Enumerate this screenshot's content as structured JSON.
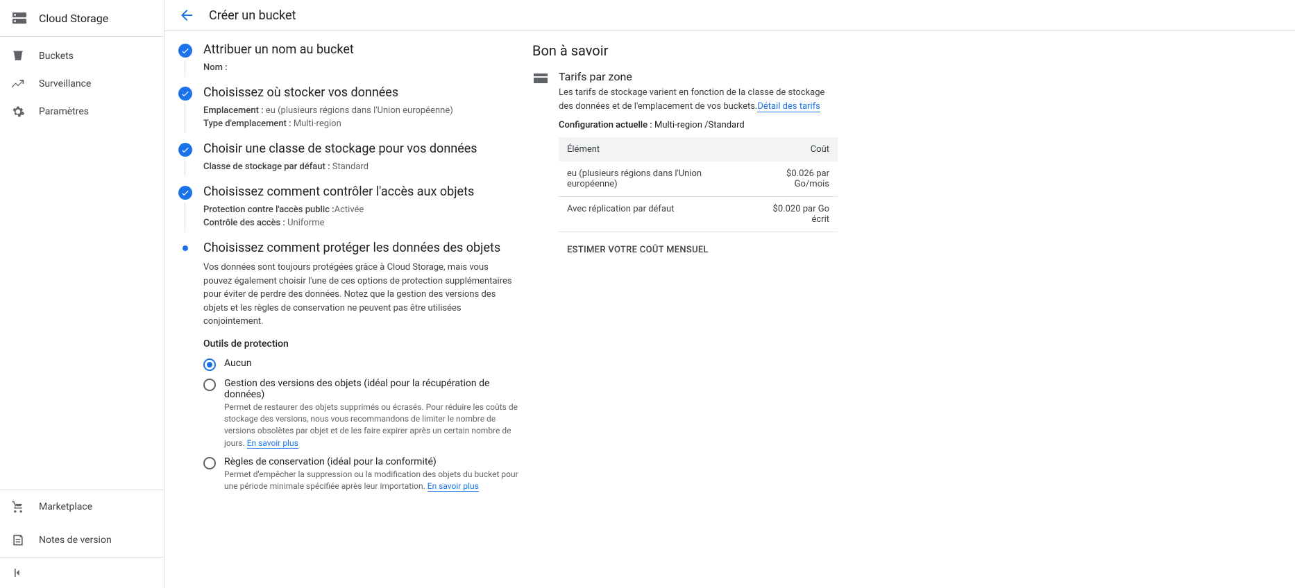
{
  "sidebar": {
    "product_title": "Cloud Storage",
    "nav": [
      {
        "label": "Buckets"
      },
      {
        "label": "Surveillance"
      },
      {
        "label": "Paramètres"
      }
    ],
    "footer": [
      {
        "label": "Marketplace"
      },
      {
        "label": "Notes de version"
      }
    ]
  },
  "topbar": {
    "title": "Créer un bucket"
  },
  "steps": {
    "name": {
      "title": "Attribuer un nom au bucket",
      "name_label": "Nom :"
    },
    "location": {
      "title": "Choisissez où stocker vos données",
      "loc_label": "Emplacement :",
      "loc_value": "eu (plusieurs régions dans l'Union européenne)",
      "type_label": "Type d'emplacement :",
      "type_value": "Multi-region"
    },
    "storage_class": {
      "title": "Choisir une classe de stockage pour vos données",
      "class_label": "Classe de stockage par défaut :",
      "class_value": "Standard"
    },
    "access": {
      "title": "Choisissez comment contrôler l'accès aux objets",
      "pub_label": "Protection contre l'accès public :",
      "pub_value": "Activée",
      "ctrl_label": "Contrôle des accès :",
      "ctrl_value": "Uniforme"
    },
    "protect": {
      "title": "Choisissez comment protéger les données des objets",
      "desc": "Vos données sont toujours protégées grâce à Cloud Storage, mais vous pouvez également choisir l'une de ces options de protection supplémentaires pour éviter de perdre des données. Notez que la gestion des versions des objets et les règles de conservation ne peuvent pas être utilisées conjointement.",
      "tools_label": "Outils de protection",
      "options": {
        "none": {
          "label": "Aucun"
        },
        "versioning": {
          "label": "Gestion des versions des objets (idéal pour la récupération de données)",
          "help": "Permet de restaurer des objets supprimés ou écrasés. Pour réduire les coûts de stockage des versions, nous vous recommandons de limiter le nombre de versions obsolètes par objet et de les faire expirer après un certain nombre de jours. ",
          "link": "En savoir plus"
        },
        "retention": {
          "label": "Règles de conservation (idéal pour la conformité)",
          "help": "Permet d'empêcher la suppression ou la modification des objets du bucket pour une période minimale spécifiée après leur importation. ",
          "link": "En savoir plus"
        }
      }
    }
  },
  "info": {
    "title": "Bon à savoir",
    "pricing_heading": "Tarifs par zone",
    "pricing_text": "Les tarifs de stockage varient en fonction de la classe de stockage des données et de l'emplacement de vos buckets.",
    "pricing_link": "Détail des tarifs",
    "config_label": "Configuration actuelle :",
    "config_value": "Multi-region /Standard",
    "table": {
      "col_element": "Élément",
      "col_cost": "Coût",
      "rows": [
        {
          "element": "eu (plusieurs régions dans l'Union européenne)",
          "cost": "$0.026 par Go/mois"
        },
        {
          "element": "Avec réplication par défaut",
          "cost": "$0.020 par Go écrit"
        }
      ]
    },
    "estimate_button": "ESTIMER VOTRE COÛT MENSUEL"
  }
}
